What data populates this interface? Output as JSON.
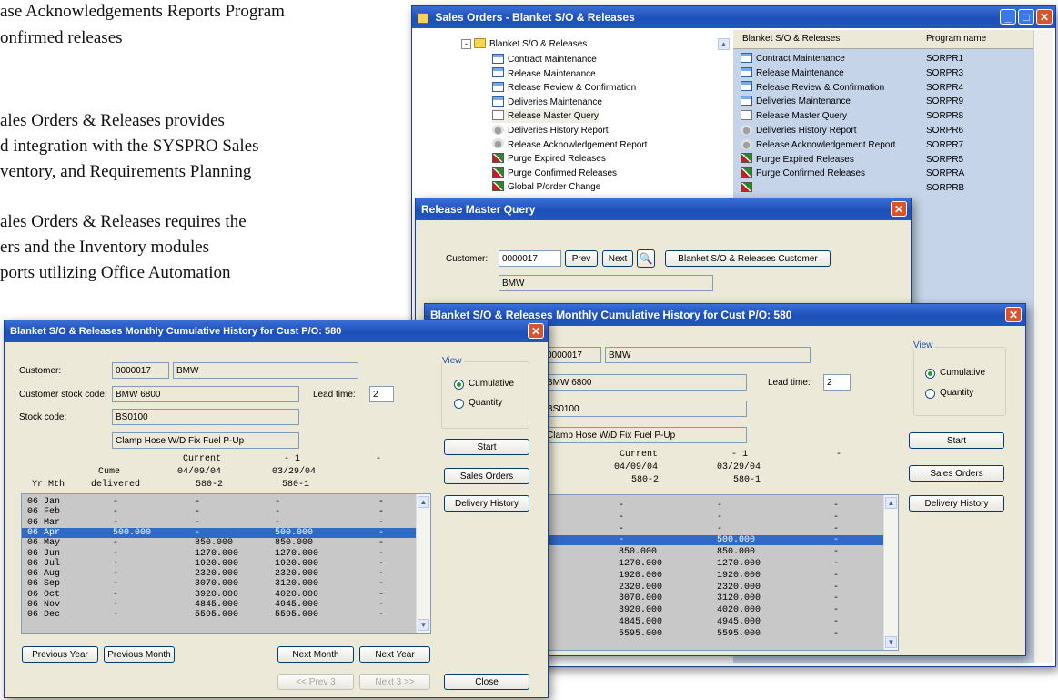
{
  "doc": {
    "lines": [
      "ase Acknowledgements Reports Program",
      "onfirmed releases",
      "ales Orders & Releases provides",
      "d integration with the SYSPRO Sales",
      "ventory, and Requirements Planning",
      "ales Orders & Releases requires the",
      "ers and the Inventory modules",
      "ports utilizing Office Automation"
    ]
  },
  "main_window": {
    "title": "Sales Orders - Blanket S/O & Releases",
    "tree_root": "Blanket S/O & Releases",
    "tree_items": [
      {
        "label": "Contract Maintenance",
        "icon": "program-icon"
      },
      {
        "label": "Release Maintenance",
        "icon": "program-icon"
      },
      {
        "label": "Release Review & Confirmation",
        "icon": "program-icon"
      },
      {
        "label": "Deliveries Maintenance",
        "icon": "program-icon"
      },
      {
        "label": "Release Master Query",
        "icon": "query-icon"
      },
      {
        "label": "Deliveries History Report",
        "icon": "report-icon"
      },
      {
        "label": "Release Acknowledgement Report",
        "icon": "report-icon"
      },
      {
        "label": "Purge Expired Releases",
        "icon": "purge-icon"
      },
      {
        "label": "Purge Confirmed Releases",
        "icon": "purge-icon"
      },
      {
        "label": "Global P/order Change",
        "icon": "purge-icon"
      }
    ],
    "list_headers": [
      "Blanket S/O & Releases",
      "Program name"
    ],
    "list_rows": [
      {
        "name": "Contract Maintenance",
        "program": "SORPR1",
        "icon": "program-icon"
      },
      {
        "name": "Release Maintenance",
        "program": "SORPR3",
        "icon": "program-icon"
      },
      {
        "name": "Release Review & Confirmation",
        "program": "SORPR4",
        "icon": "program-icon"
      },
      {
        "name": "Deliveries Maintenance",
        "program": "SORPR9",
        "icon": "program-icon"
      },
      {
        "name": "Release Master Query",
        "program": "SORPR8",
        "icon": "query-icon"
      },
      {
        "name": "Deliveries History Report",
        "program": "SORPR6",
        "icon": "report-icon"
      },
      {
        "name": "Release Acknowledgement Report",
        "program": "SORPR7",
        "icon": "report-icon"
      },
      {
        "name": "Purge Expired Releases",
        "program": "SORPR5",
        "icon": "purge-icon"
      },
      {
        "name": "Purge Confirmed Releases",
        "program": "SORPRA",
        "icon": "purge-icon"
      },
      {
        "name": "",
        "program": "SORPRB",
        "icon": "purge-icon"
      }
    ]
  },
  "release_query": {
    "title": "Release Master Query",
    "customer_label": "Customer:",
    "customer_value": "0000017",
    "prev_label": "Prev",
    "next_label": "Next",
    "customer_button": "Blanket S/O & Releases Customer",
    "customer_name": "BMW"
  },
  "history": {
    "title": "Blanket S/O & Releases Monthly Cumulative History for Cust P/O: 580",
    "customer_label": "Customer:",
    "customer_code": "0000017",
    "customer_name": "BMW",
    "stock_code_label": "Customer stock code:",
    "stock_code_value": "BMW 6800",
    "lead_time_label": "Lead time:",
    "lead_time_value": "2",
    "stock_label": "Stock code:",
    "stock_value": "BS0100",
    "description": "Clamp Hose W/D Fix Fuel P-Up",
    "col_current": "Current",
    "col_minus1": "- 1",
    "col_minus2": "-",
    "date_current": "04/09/04",
    "date_minus1": "03/29/04",
    "cume_label": "Cume",
    "delivered_label": "delivered",
    "ref_current": "580-2",
    "ref_minus1": "580-1",
    "yrmth_label": "Yr Mth",
    "rows": [
      {
        "month": "06 Jan",
        "cume": "-",
        "current": "-",
        "minus1": "-",
        "minus2": "-"
      },
      {
        "month": "06 Feb",
        "cume": "-",
        "current": "-",
        "minus1": "-",
        "minus2": "-"
      },
      {
        "month": "06 Mar",
        "cume": "-",
        "current": "-",
        "minus1": "-",
        "minus2": "-"
      },
      {
        "month": "06 Apr",
        "cume": "500.000",
        "current": "-",
        "minus1": "500.000",
        "minus2": "-"
      },
      {
        "month": "06 May",
        "cume": "-",
        "current": "850.000",
        "minus1": "850.000",
        "minus2": "-"
      },
      {
        "month": "06 Jun",
        "cume": "-",
        "current": "1270.000",
        "minus1": "1270.000",
        "minus2": "-"
      },
      {
        "month": "06 Jul",
        "cume": "-",
        "current": "1920.000",
        "minus1": "1920.000",
        "minus2": "-"
      },
      {
        "month": "06 Aug",
        "cume": "-",
        "current": "2320.000",
        "minus1": "2320.000",
        "minus2": "-"
      },
      {
        "month": "06 Sep",
        "cume": "-",
        "current": "3070.000",
        "minus1": "3120.000",
        "minus2": "-"
      },
      {
        "month": "06 Oct",
        "cume": "-",
        "current": "3920.000",
        "minus1": "4020.000",
        "minus2": "-"
      },
      {
        "month": "06 Nov",
        "cume": "-",
        "current": "4845.000",
        "minus1": "4945.000",
        "minus2": "-"
      },
      {
        "month": "06 Dec",
        "cume": "-",
        "current": "5595.000",
        "minus1": "5595.000",
        "minus2": "-"
      }
    ],
    "selected_row": 3,
    "view_label": "View",
    "cumulative_label": "Cumulative",
    "quantity_label": "Quantity",
    "start_label": "Start",
    "sales_orders_label": "Sales Orders",
    "delivery_history_label": "Delivery History",
    "prev_year_label": "Previous Year",
    "prev_month_label": "Previous Month",
    "next_month_label": "Next Month",
    "next_year_label": "Next Year",
    "prev3_label": "<< Prev 3",
    "next3_label": "Next 3 >>",
    "close_label": "Close"
  },
  "colors": {
    "selection": "#316ac5",
    "titlebar": "#1d4fb8",
    "grid": "#c8c8c8"
  }
}
